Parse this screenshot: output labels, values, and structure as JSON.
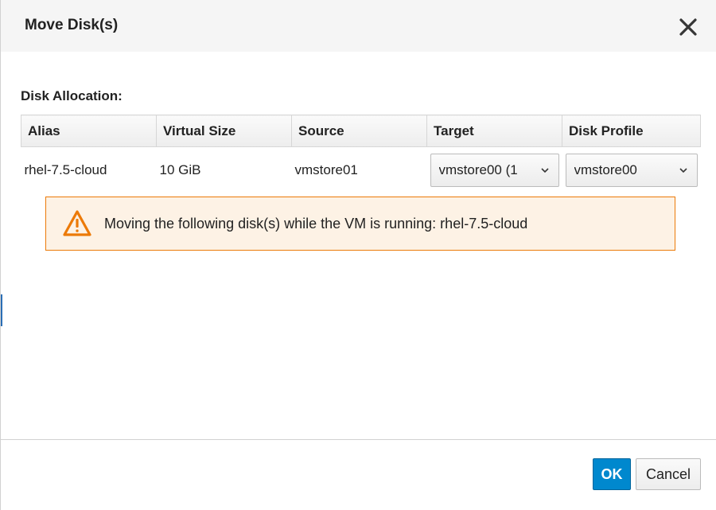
{
  "dialog": {
    "title": "Move Disk(s)",
    "close_icon": "close-icon"
  },
  "allocation": {
    "label": "Disk Allocation:",
    "columns": [
      "Alias",
      "Virtual Size",
      "Source",
      "Target",
      "Disk Profile"
    ],
    "rows": [
      {
        "alias": "rhel-7.5-cloud",
        "virtual_size": "10 GiB",
        "source": "vmstore01",
        "target": "vmstore00 (1",
        "disk_profile": "vmstore00"
      }
    ]
  },
  "alert": {
    "icon": "warning-icon",
    "message": "Moving the following disk(s) while the VM is running: rhel-7.5-cloud",
    "border_color": "#ec7a08",
    "background": "#fdf2e5"
  },
  "footer": {
    "ok_label": "OK",
    "cancel_label": "Cancel",
    "ok_color": "#0088ce"
  }
}
